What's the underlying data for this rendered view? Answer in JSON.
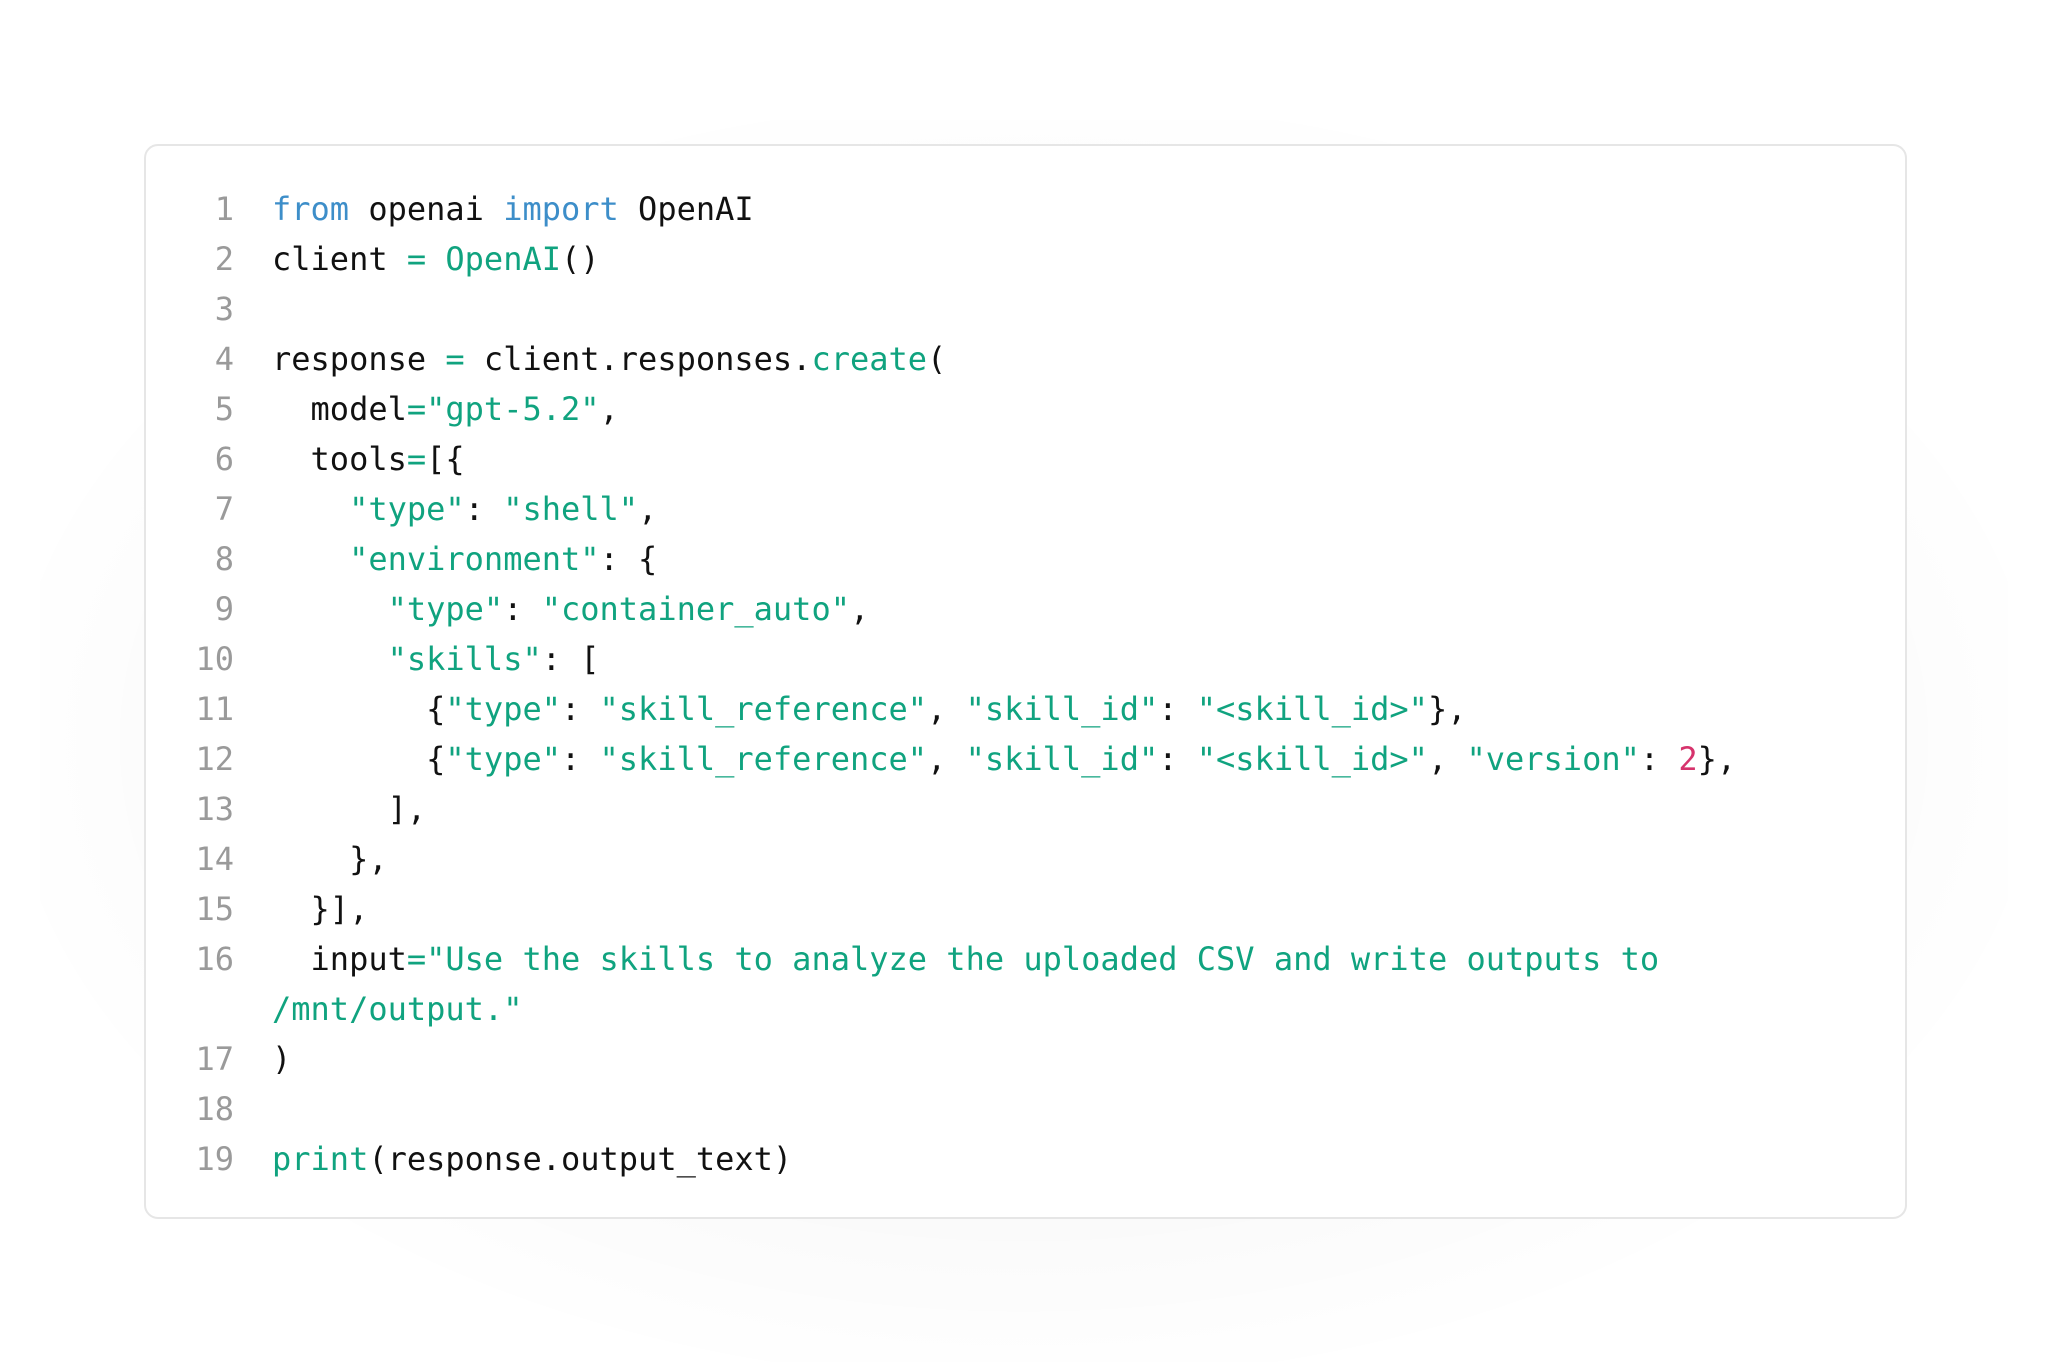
{
  "code": {
    "language": "python",
    "lines": [
      {
        "number": "1",
        "tokens": [
          {
            "t": "k",
            "v": "from"
          },
          {
            "t": "p",
            "v": " openai "
          },
          {
            "t": "k",
            "v": "import"
          },
          {
            "t": "p",
            "v": " OpenAI"
          }
        ]
      },
      {
        "number": "2",
        "tokens": [
          {
            "t": "p",
            "v": "client "
          },
          {
            "t": "o",
            "v": "="
          },
          {
            "t": "p",
            "v": " "
          },
          {
            "t": "f",
            "v": "OpenAI"
          },
          {
            "t": "p",
            "v": "()"
          }
        ]
      },
      {
        "number": "3",
        "tokens": []
      },
      {
        "number": "4",
        "tokens": [
          {
            "t": "p",
            "v": "response "
          },
          {
            "t": "o",
            "v": "="
          },
          {
            "t": "p",
            "v": " client.responses."
          },
          {
            "t": "f",
            "v": "create"
          },
          {
            "t": "p",
            "v": "("
          }
        ]
      },
      {
        "number": "5",
        "tokens": [
          {
            "t": "p",
            "v": "  model"
          },
          {
            "t": "o",
            "v": "="
          },
          {
            "t": "s",
            "v": "\"gpt-5.2\""
          },
          {
            "t": "p",
            "v": ","
          }
        ]
      },
      {
        "number": "6",
        "tokens": [
          {
            "t": "p",
            "v": "  tools"
          },
          {
            "t": "o",
            "v": "="
          },
          {
            "t": "p",
            "v": "[{"
          }
        ]
      },
      {
        "number": "7",
        "tokens": [
          {
            "t": "p",
            "v": "    "
          },
          {
            "t": "s",
            "v": "\"type\""
          },
          {
            "t": "p",
            "v": ": "
          },
          {
            "t": "s",
            "v": "\"shell\""
          },
          {
            "t": "p",
            "v": ","
          }
        ]
      },
      {
        "number": "8",
        "tokens": [
          {
            "t": "p",
            "v": "    "
          },
          {
            "t": "s",
            "v": "\"environment\""
          },
          {
            "t": "p",
            "v": ": {"
          }
        ]
      },
      {
        "number": "9",
        "tokens": [
          {
            "t": "p",
            "v": "      "
          },
          {
            "t": "s",
            "v": "\"type\""
          },
          {
            "t": "p",
            "v": ": "
          },
          {
            "t": "s",
            "v": "\"container_auto\""
          },
          {
            "t": "p",
            "v": ","
          }
        ]
      },
      {
        "number": "10",
        "tokens": [
          {
            "t": "p",
            "v": "      "
          },
          {
            "t": "s",
            "v": "\"skills\""
          },
          {
            "t": "p",
            "v": ": ["
          }
        ]
      },
      {
        "number": "11",
        "tokens": [
          {
            "t": "p",
            "v": "        {"
          },
          {
            "t": "s",
            "v": "\"type\""
          },
          {
            "t": "p",
            "v": ": "
          },
          {
            "t": "s",
            "v": "\"skill_reference\""
          },
          {
            "t": "p",
            "v": ", "
          },
          {
            "t": "s",
            "v": "\"skill_id\""
          },
          {
            "t": "p",
            "v": ": "
          },
          {
            "t": "s",
            "v": "\"<skill_id>\""
          },
          {
            "t": "p",
            "v": "},"
          }
        ]
      },
      {
        "number": "12",
        "tokens": [
          {
            "t": "p",
            "v": "        {"
          },
          {
            "t": "s",
            "v": "\"type\""
          },
          {
            "t": "p",
            "v": ": "
          },
          {
            "t": "s",
            "v": "\"skill_reference\""
          },
          {
            "t": "p",
            "v": ", "
          },
          {
            "t": "s",
            "v": "\"skill_id\""
          },
          {
            "t": "p",
            "v": ": "
          },
          {
            "t": "s",
            "v": "\"<skill_id>\""
          },
          {
            "t": "p",
            "v": ", "
          },
          {
            "t": "s",
            "v": "\"version\""
          },
          {
            "t": "p",
            "v": ": "
          },
          {
            "t": "n",
            "v": "2"
          },
          {
            "t": "p",
            "v": "},"
          }
        ]
      },
      {
        "number": "13",
        "tokens": [
          {
            "t": "p",
            "v": "      ],"
          }
        ]
      },
      {
        "number": "14",
        "tokens": [
          {
            "t": "p",
            "v": "    },"
          }
        ]
      },
      {
        "number": "15",
        "tokens": [
          {
            "t": "p",
            "v": "  }],"
          }
        ]
      },
      {
        "number": "16",
        "wrapped": true,
        "tokens": [
          {
            "t": "p",
            "v": "  input"
          },
          {
            "t": "o",
            "v": "="
          },
          {
            "t": "s",
            "v": "\"Use the skills to analyze the uploaded CSV and write outputs to\n/mnt/output.\""
          }
        ]
      },
      {
        "number": "17",
        "tokens": [
          {
            "t": "p",
            "v": ")"
          }
        ]
      },
      {
        "number": "18",
        "tokens": []
      },
      {
        "number": "19",
        "tokens": [
          {
            "t": "f",
            "v": "print"
          },
          {
            "t": "p",
            "v": "(response.output_text)"
          }
        ]
      }
    ]
  },
  "colors": {
    "keyword": "#3d8ec9",
    "string": "#10a37f",
    "function": "#10a37f",
    "number": "#d6336c",
    "plain": "#111111",
    "line_number": "#9a9a9a",
    "card_border": "#e6e6e6"
  }
}
